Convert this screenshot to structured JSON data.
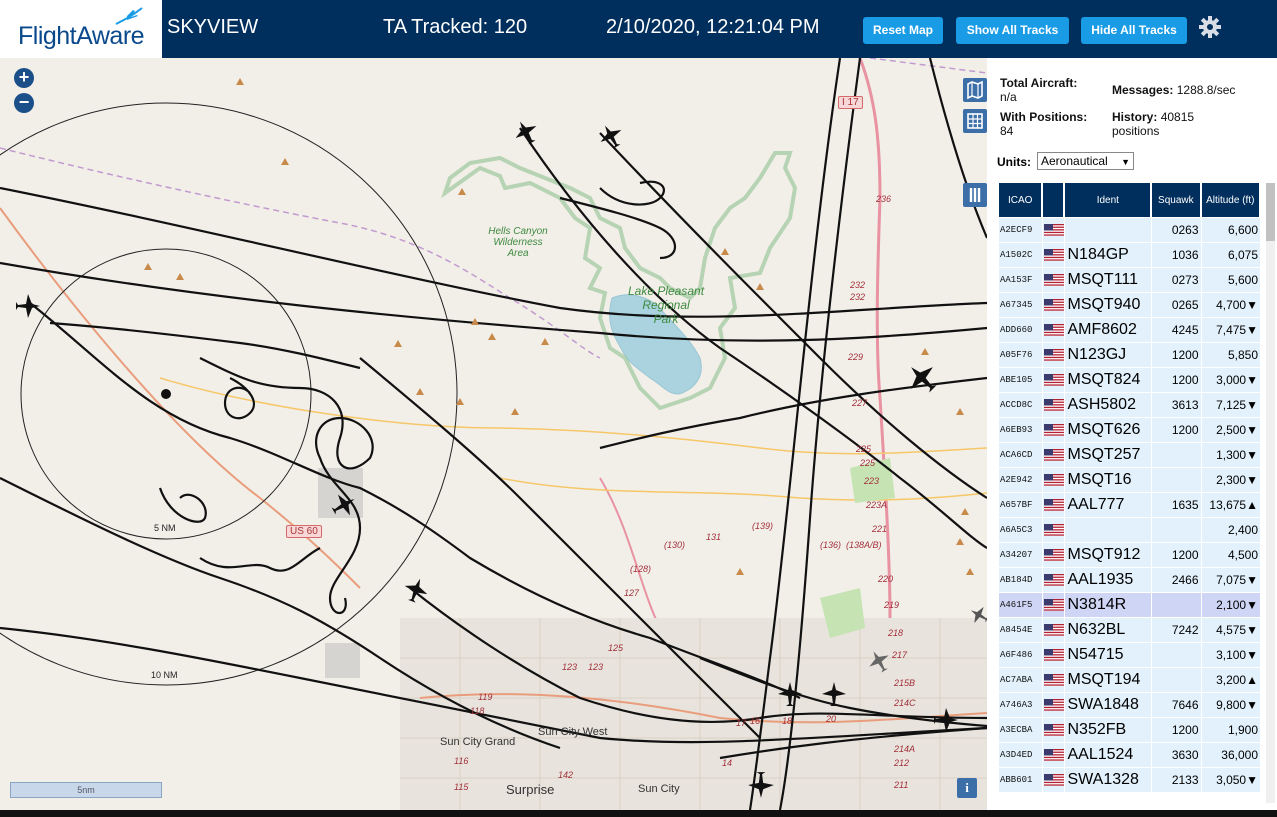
{
  "header": {
    "logo_text": "FlightAware",
    "app_title": "SKYVIEW",
    "ta_tracked": "TA Tracked: 120",
    "datetime": "2/10/2020, 12:21:04 PM",
    "reset_map": "Reset Map",
    "show_all_tracks": "Show All Tracks",
    "hide_all_tracks": "Hide All Tracks",
    "settings_icon": "gear-icon"
  },
  "map": {
    "zoom_in": "+",
    "zoom_out": "−",
    "labels": {
      "hells_canyon": [
        "Hells Canyon",
        "Wilderness",
        "Area"
      ],
      "lake_pleasant": [
        "Lake Pleasant",
        "Regional",
        "Park"
      ],
      "sun_city_grand": "Sun City Grand",
      "sun_city_west": "Sun City West",
      "surprise": "Surprise",
      "sun_city": "Sun City",
      "i17": "I 17",
      "us60": "US 60",
      "ring_5nm": "5 NM",
      "ring_10nm": "10 NM"
    },
    "route_numbers": [
      "236",
      "232",
      "232",
      "229",
      "227",
      "225",
      "225",
      "223",
      "223A",
      "221",
      "220",
      "219",
      "218",
      "217",
      "215B",
      "214C",
      "214A",
      "212",
      "211",
      "131",
      "(130)",
      "(128)",
      "127",
      "125",
      "123",
      "123",
      "119",
      "118",
      "116",
      "115",
      "142",
      "14",
      "16",
      "17",
      "18",
      "20",
      "(136)",
      "(138A/B)",
      "(139)"
    ],
    "scale_label": "5nm",
    "info": "i",
    "side_buttons": [
      "map-icon",
      "grid-icon",
      "columns-icon"
    ]
  },
  "panel": {
    "total_aircraft_label": "Total Aircraft:",
    "total_aircraft_value": "n/a",
    "messages_label": "Messages:",
    "messages_value": "1288.8/sec",
    "with_positions_label": "With Positions:",
    "with_positions_value": "84",
    "history_label": "History:",
    "history_value": "40815",
    "history_unit": "positions",
    "units_label": "Units:",
    "units_value": "Aeronautical",
    "columns": [
      "ICAO",
      "",
      "Ident",
      "Squawk",
      "Altitude (ft)"
    ],
    "rows": [
      {
        "icao": "A2ECF9",
        "ident": "",
        "squawk": "0263",
        "alt": "6,600",
        "trend": ""
      },
      {
        "icao": "A1502C",
        "ident": "N184GP",
        "squawk": "1036",
        "alt": "6,075",
        "trend": ""
      },
      {
        "icao": "AA153F",
        "ident": "MSQT111",
        "squawk": "0273",
        "alt": "5,600",
        "trend": ""
      },
      {
        "icao": "A67345",
        "ident": "MSQT940",
        "squawk": "0265",
        "alt": "4,700",
        "trend": "▼"
      },
      {
        "icao": "ADD660",
        "ident": "AMF8602",
        "squawk": "4245",
        "alt": "7,475",
        "trend": "▼"
      },
      {
        "icao": "A05F76",
        "ident": "N123GJ",
        "squawk": "1200",
        "alt": "5,850",
        "trend": ""
      },
      {
        "icao": "ABE105",
        "ident": "MSQT824",
        "squawk": "1200",
        "alt": "3,000",
        "trend": "▼"
      },
      {
        "icao": "ACCD8C",
        "ident": "ASH5802",
        "squawk": "3613",
        "alt": "7,125",
        "trend": "▼"
      },
      {
        "icao": "A6EB93",
        "ident": "MSQT626",
        "squawk": "1200",
        "alt": "2,500",
        "trend": "▼"
      },
      {
        "icao": "ACA6CD",
        "ident": "MSQT257",
        "squawk": "",
        "alt": "1,300",
        "trend": "▼"
      },
      {
        "icao": "A2E942",
        "ident": "MSQT16",
        "squawk": "",
        "alt": "2,300",
        "trend": "▼"
      },
      {
        "icao": "A657BF",
        "ident": "AAL777",
        "squawk": "1635",
        "alt": "13,675",
        "trend": "▲"
      },
      {
        "icao": "A6A5C3",
        "ident": "",
        "squawk": "",
        "alt": "2,400",
        "trend": ""
      },
      {
        "icao": "A34207",
        "ident": "MSQT912",
        "squawk": "1200",
        "alt": "4,500",
        "trend": ""
      },
      {
        "icao": "AB184D",
        "ident": "AAL1935",
        "squawk": "2466",
        "alt": "7,075",
        "trend": "▼"
      },
      {
        "icao": "A461F5",
        "ident": "N3814R",
        "squawk": "",
        "alt": "2,100",
        "trend": "▼",
        "selected": true
      },
      {
        "icao": "A8454E",
        "ident": "N632BL",
        "squawk": "7242",
        "alt": "4,575",
        "trend": "▼"
      },
      {
        "icao": "A6F486",
        "ident": "N54715",
        "squawk": "",
        "alt": "3,100",
        "trend": "▼"
      },
      {
        "icao": "AC7ABA",
        "ident": "MSQT194",
        "squawk": "",
        "alt": "3,200",
        "trend": "▲"
      },
      {
        "icao": "A746A3",
        "ident": "SWA1848",
        "squawk": "7646",
        "alt": "9,800",
        "trend": "▼"
      },
      {
        "icao": "A3ECBA",
        "ident": "N352FB",
        "squawk": "1200",
        "alt": "1,900",
        "trend": ""
      },
      {
        "icao": "A3D4ED",
        "ident": "AAL1524",
        "squawk": "3630",
        "alt": "36,000",
        "trend": ""
      },
      {
        "icao": "ABB601",
        "ident": "SWA1328",
        "squawk": "2133",
        "alt": "3,050",
        "trend": "▼"
      }
    ]
  },
  "colors": {
    "header_bg": "#002f5d",
    "button_bg": "#1a9be6",
    "row_bg": "#e2f1fb",
    "row_selected_bg": "#cfd6f5",
    "map_bg": "#f2efe9",
    "track": "#111111"
  }
}
